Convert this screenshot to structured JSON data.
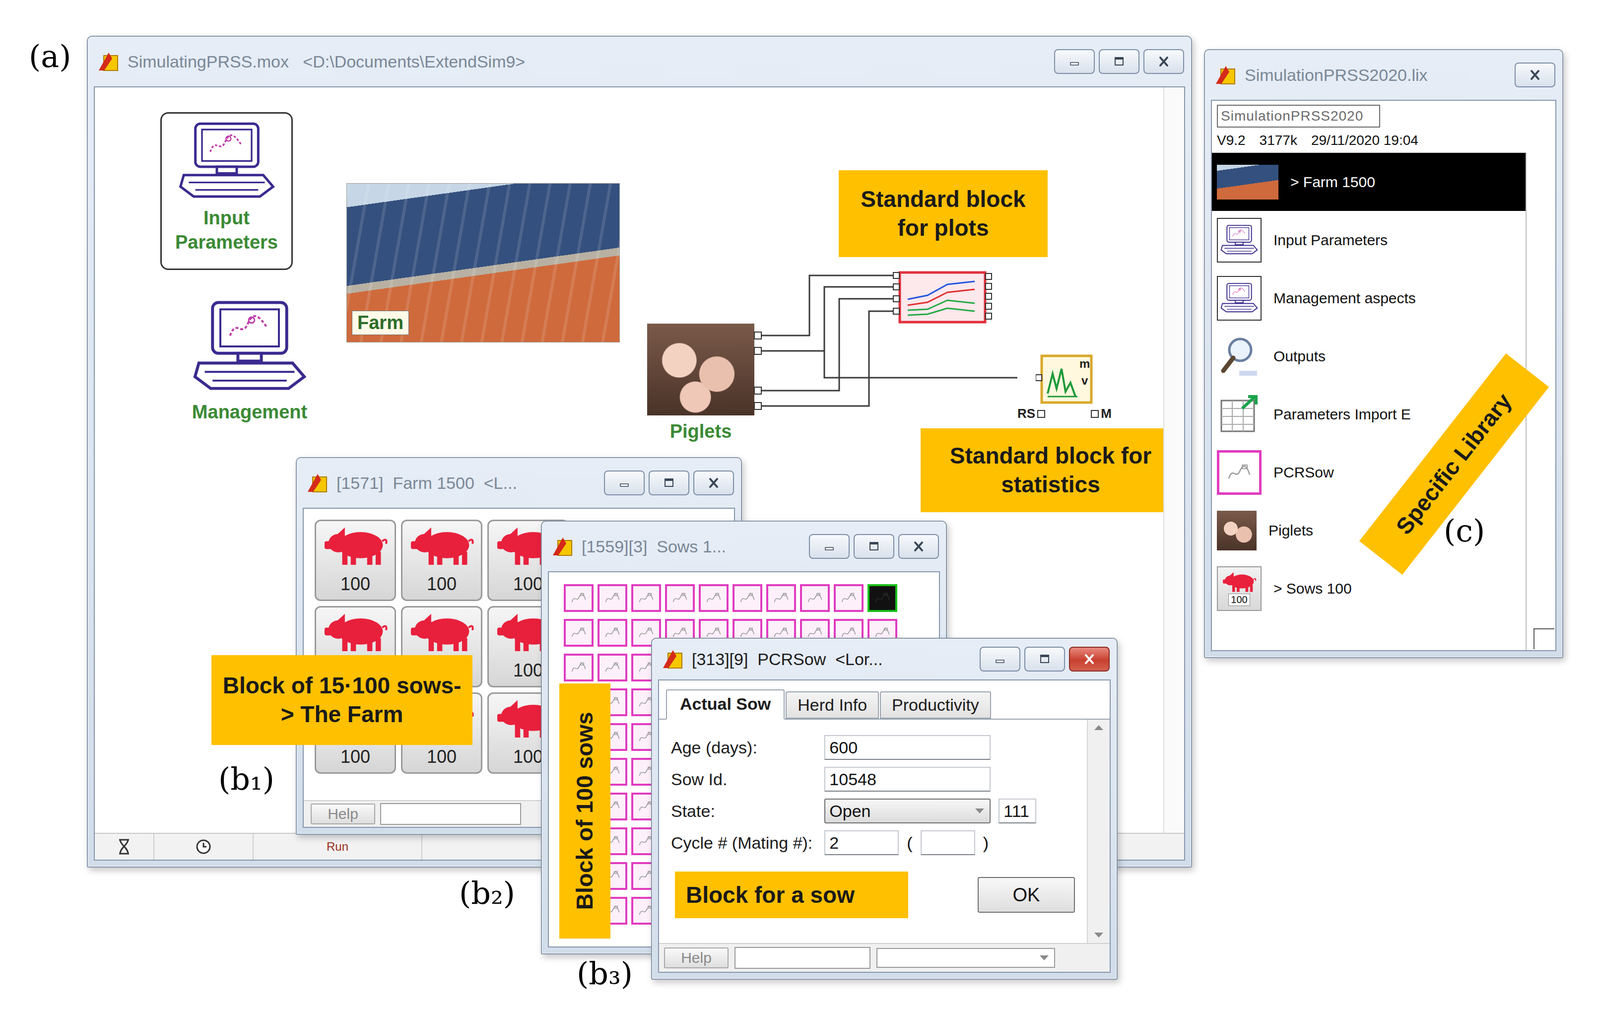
{
  "figure_labels": {
    "a": "(a)",
    "b1": "(b₁)",
    "b2": "(b₂)",
    "b3": "(b₃)",
    "c": "(c)"
  },
  "model_window": {
    "title": "SimulatingPRSS.mox   <D:\\Documents\\ExtendSim9>",
    "input_block": "Input Parameters",
    "management_block": "Management",
    "farm_block": "Farm",
    "piglets_block": "Piglets",
    "stats_block": {
      "mean": "m",
      "variance": "v",
      "ports": [
        "RS",
        "M"
      ]
    },
    "callouts": {
      "plots": "Standard block for plots",
      "statistics": "Standard block for statistics"
    },
    "status_bar": {
      "run": "Run"
    }
  },
  "farm_window": {
    "title": "[1571]  Farm 1500  <L...",
    "blocks": [
      {
        "label": "100"
      },
      {
        "label": "100"
      },
      {
        "label": "100"
      },
      {
        "label": ""
      },
      {
        "label": ""
      },
      {
        "label": "100"
      },
      {
        "label": "100"
      },
      {
        "label": "100"
      },
      {
        "label": "100"
      }
    ],
    "help": "Help",
    "callout": "Block of 15·100 sows-> The Farm"
  },
  "sows_window": {
    "title": "[1559][3]  Sows 1...",
    "rows": [
      {
        "cells": [
          {
            "selected": false
          },
          {
            "selected": false
          },
          {
            "selected": false
          },
          {
            "selected": false
          },
          {
            "selected": false
          },
          {
            "selected": false
          },
          {
            "selected": false
          },
          {
            "selected": false
          },
          {
            "selected": false
          },
          {
            "selected": true
          }
        ]
      },
      {
        "cells": [
          {
            "selected": false
          },
          {
            "selected": false
          },
          {
            "selected": false
          },
          {
            "selected": false
          },
          {
            "selected": false
          },
          {
            "selected": false
          },
          {
            "selected": false
          },
          {
            "selected": false
          },
          {
            "selected": false
          },
          {
            "selected": false
          }
        ]
      },
      {
        "cells": [
          {
            "selected": false
          },
          {
            "selected": false
          },
          {
            "selected": false
          },
          {
            "selected": false
          },
          {
            "selected": false
          },
          {
            "selected": false
          },
          {
            "selected": false
          },
          {
            "selected": false
          },
          {
            "selected": false
          },
          {
            "selected": false
          }
        ]
      },
      {
        "cells": [
          {
            "selected": false
          },
          {
            "selected": false
          },
          {
            "selected": false
          },
          {
            "selected": false
          },
          {
            "selected": false
          },
          {
            "selected": false
          },
          {
            "selected": false
          },
          {
            "selected": false
          },
          {
            "selected": false
          },
          {
            "selected": false
          }
        ]
      },
      {
        "cells": [
          {
            "selected": false
          },
          {
            "selected": false
          },
          {
            "selected": false
          },
          {
            "selected": false
          },
          {
            "selected": false
          },
          {
            "selected": false
          },
          {
            "selected": false
          },
          {
            "selected": false
          },
          {
            "selected": false
          },
          {
            "selected": false
          }
        ]
      },
      {
        "cells": [
          {
            "selected": false
          },
          {
            "selected": false
          },
          {
            "selected": false
          },
          {
            "selected": false
          },
          {
            "selected": false
          },
          {
            "selected": false
          },
          {
            "selected": false
          },
          {
            "selected": false
          },
          {
            "selected": false
          },
          {
            "selected": false
          }
        ]
      },
      {
        "cells": [
          {
            "selected": false
          },
          {
            "selected": false
          },
          {
            "selected": false
          },
          {
            "selected": false
          },
          {
            "selected": false
          },
          {
            "selected": false
          },
          {
            "selected": false
          },
          {
            "selected": false
          },
          {
            "selected": false
          },
          {
            "selected": false
          }
        ]
      },
      {
        "cells": [
          {
            "selected": false
          },
          {
            "selected": false
          },
          {
            "selected": false
          },
          {
            "selected": false
          },
          {
            "selected": false
          },
          {
            "selected": false
          },
          {
            "selected": false
          },
          {
            "selected": false
          },
          {
            "selected": false
          },
          {
            "selected": false
          }
        ]
      },
      {
        "cells": [
          {
            "selected": false
          },
          {
            "selected": false
          },
          {
            "selected": false
          },
          {
            "selected": false
          },
          {
            "selected": false
          },
          {
            "selected": false
          },
          {
            "selected": false
          },
          {
            "selected": false
          },
          {
            "selected": false
          },
          {
            "selected": false
          }
        ]
      },
      {
        "cells": [
          {
            "selected": false
          },
          {
            "selected": false
          },
          {
            "selected": false
          },
          {
            "selected": false
          },
          {
            "selected": false
          },
          {
            "selected": false
          },
          {
            "selected": false
          },
          {
            "selected": false
          },
          {
            "selected": false
          },
          {
            "selected": false
          }
        ]
      }
    ],
    "callout": "Block of 100 sows"
  },
  "sow_dialog": {
    "title": "[313][9]  PCRSow  <Lor...",
    "tabs": [
      {
        "label": "Actual Sow",
        "selected": true
      },
      {
        "label": "Herd Info",
        "selected": false
      },
      {
        "label": "Productivity",
        "selected": false
      }
    ],
    "fields": [
      {
        "label": "Age (days):",
        "value": "600",
        "kind": "text"
      },
      {
        "label": "Sow Id.",
        "value": "10548",
        "kind": "text"
      },
      {
        "label": "State:",
        "value": "Open",
        "extra": "111",
        "kind": "select"
      },
      {
        "label": "Cycle # (Mating #):",
        "value": "2",
        "open": "(",
        "close": ")",
        "kind": "cycle"
      }
    ],
    "callout": "Block for a sow",
    "ok": "OK",
    "help": "Help"
  },
  "library": {
    "title": "SimulationPRSS2020.lix",
    "name_field": "SimulationPRSS2020",
    "version": "V9.2",
    "size": "3177k",
    "date": "29/11/2020 19:04",
    "items": [
      {
        "label": "> Farm 1500",
        "selected": true,
        "kind": "photo"
      },
      {
        "label": "Input Parameters",
        "selected": false,
        "kind": "computer"
      },
      {
        "label": "Management aspects",
        "selected": false,
        "kind": "computer"
      },
      {
        "label": "Outputs",
        "selected": false,
        "kind": "magnifier"
      },
      {
        "label": "Parameters Import E",
        "selected": false,
        "kind": "table"
      },
      {
        "label": "PCRSow",
        "selected": false,
        "kind": "sow"
      },
      {
        "label": "Piglets",
        "selected": false,
        "kind": "piglets"
      },
      {
        "label": "> Sows 100",
        "selected": false,
        "kind": "pig",
        "badge": "100"
      }
    ],
    "callout": "Specific Library"
  }
}
